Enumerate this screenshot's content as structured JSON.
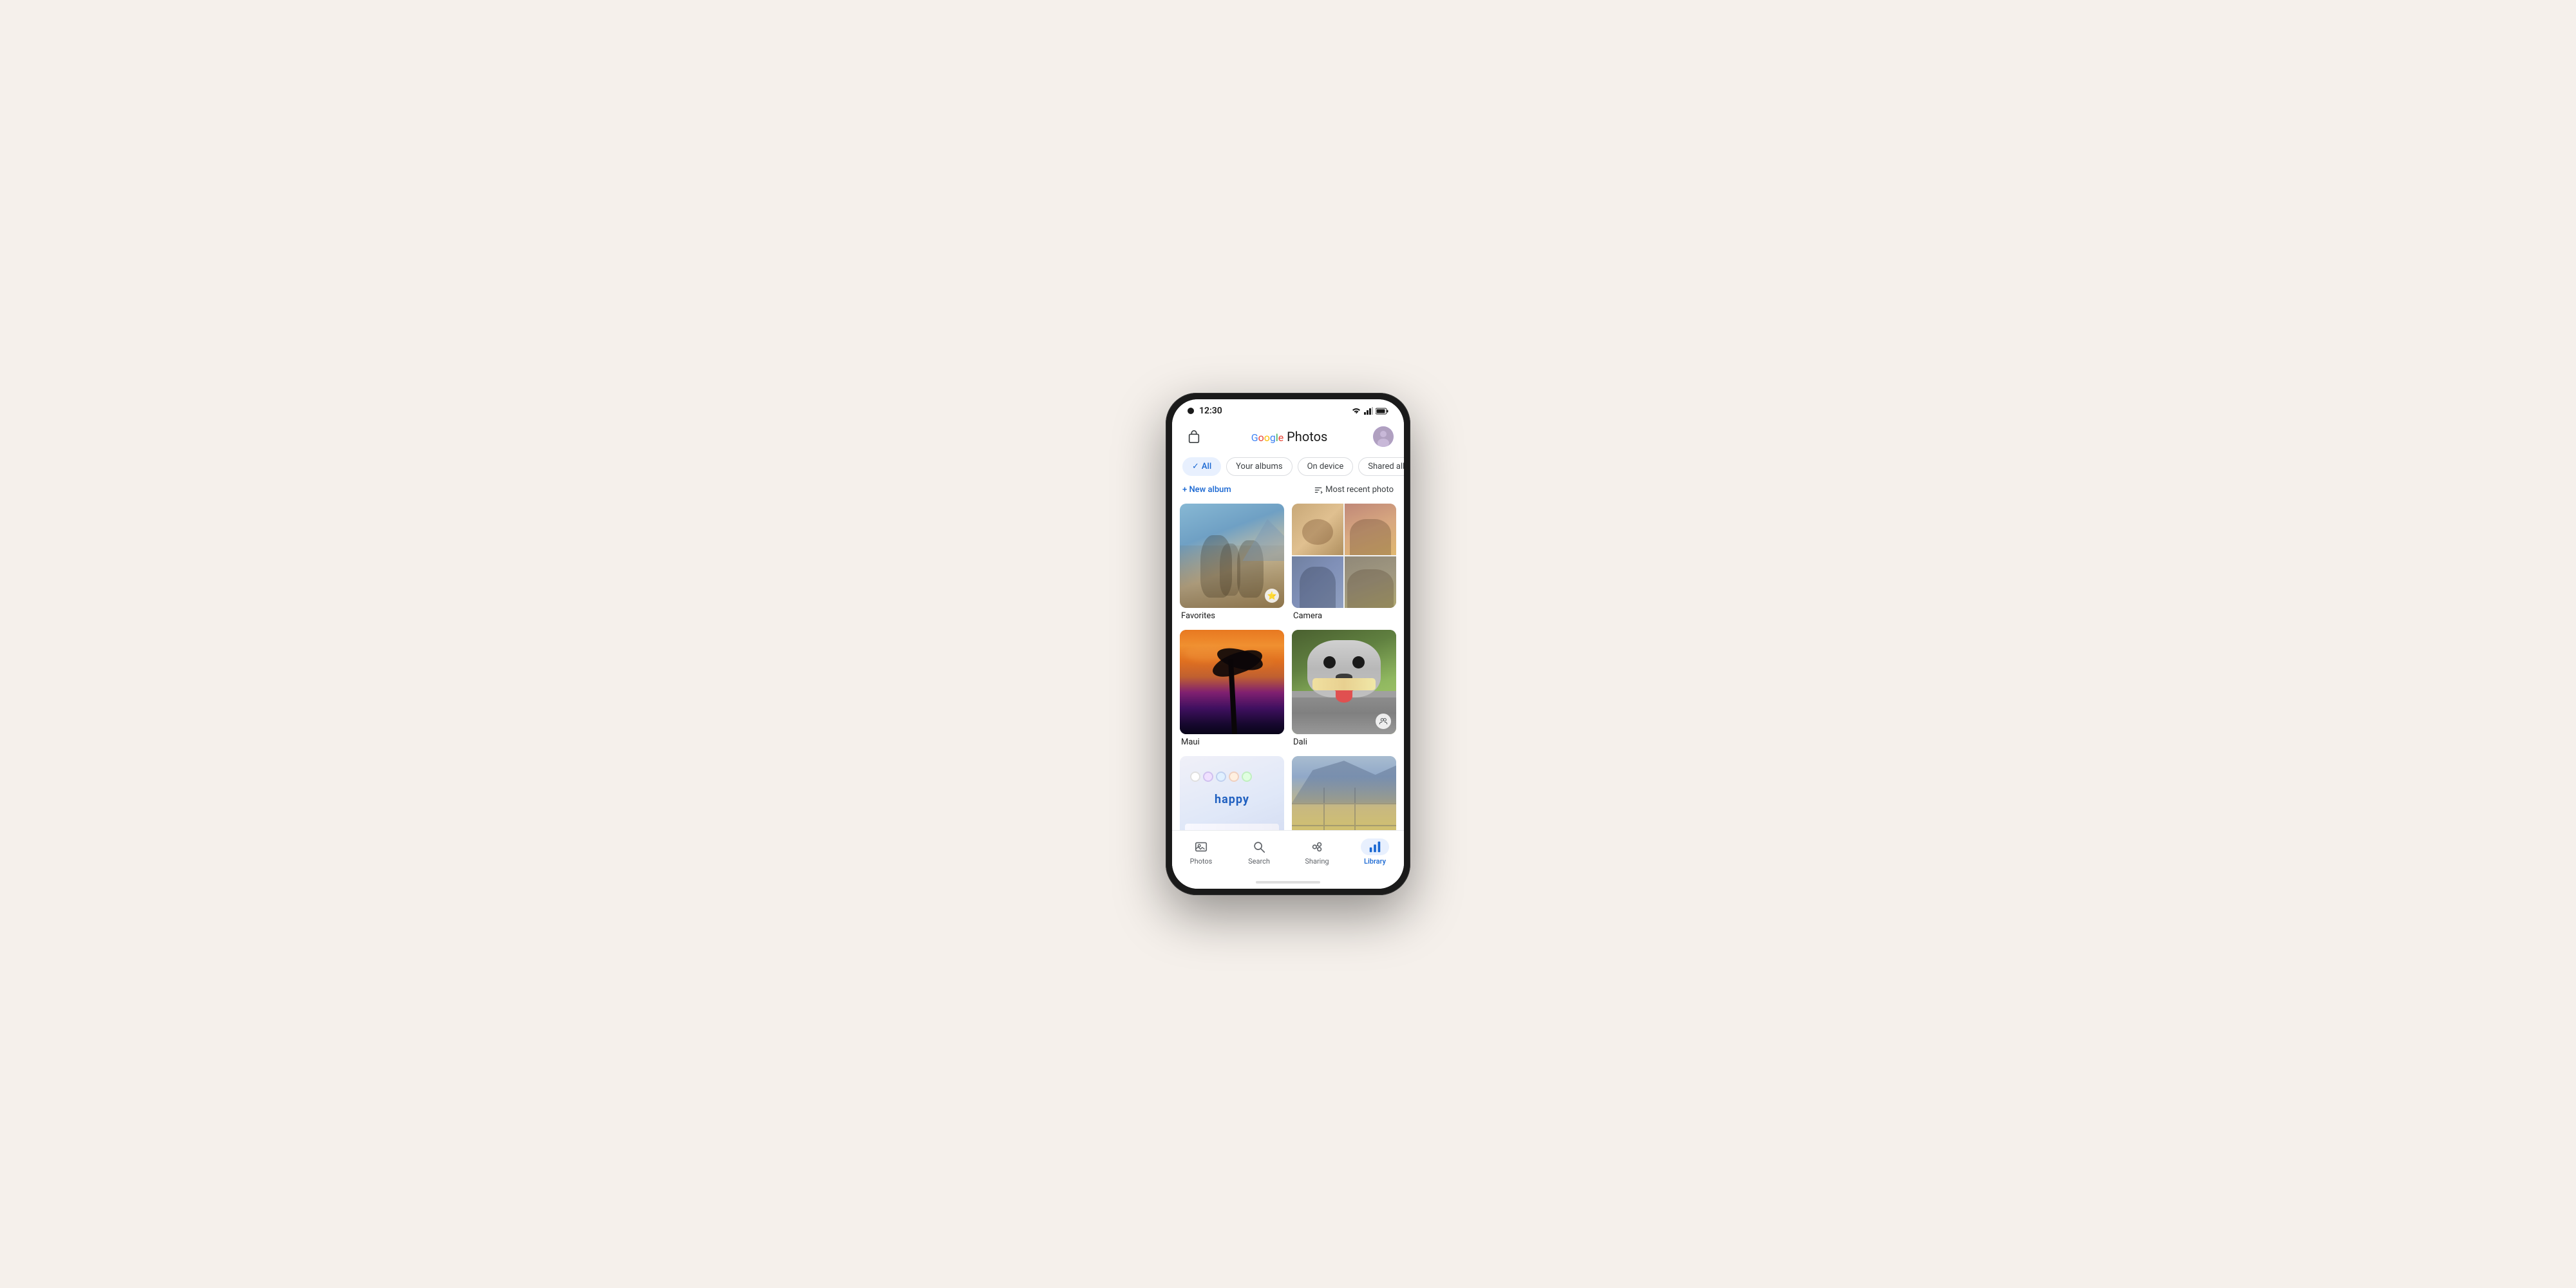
{
  "status": {
    "time": "12:30",
    "wifi": "▲",
    "signal": "▼",
    "battery": "▋"
  },
  "header": {
    "logo_google": "Google",
    "logo_photos": " Photos",
    "bag_label": "shopping bag"
  },
  "filters": {
    "tabs": [
      {
        "id": "all",
        "label": "All",
        "active": true
      },
      {
        "id": "your-albums",
        "label": "Your albums",
        "active": false
      },
      {
        "id": "on-device",
        "label": "On device",
        "active": false
      },
      {
        "id": "shared-albums",
        "label": "Shared albu…",
        "active": false
      }
    ]
  },
  "actions": {
    "new_album": "+ New album",
    "sort": "Most recent photo"
  },
  "albums": [
    {
      "id": "favorites",
      "label": "Favorites",
      "type": "single"
    },
    {
      "id": "camera",
      "label": "Camera",
      "type": "quad"
    },
    {
      "id": "maui",
      "label": "Maui",
      "type": "single"
    },
    {
      "id": "dali",
      "label": "Dali",
      "type": "single",
      "shared": true
    },
    {
      "id": "happy",
      "label": "",
      "type": "single"
    },
    {
      "id": "aerial",
      "label": "",
      "type": "single"
    }
  ],
  "bottom_nav": {
    "items": [
      {
        "id": "photos",
        "label": "Photos",
        "icon": "🖼",
        "active": false
      },
      {
        "id": "search",
        "label": "Search",
        "icon": "🔍",
        "active": false
      },
      {
        "id": "sharing",
        "label": "Sharing",
        "icon": "👥",
        "active": false
      },
      {
        "id": "library",
        "label": "Library",
        "icon": "📊",
        "active": true
      }
    ]
  }
}
